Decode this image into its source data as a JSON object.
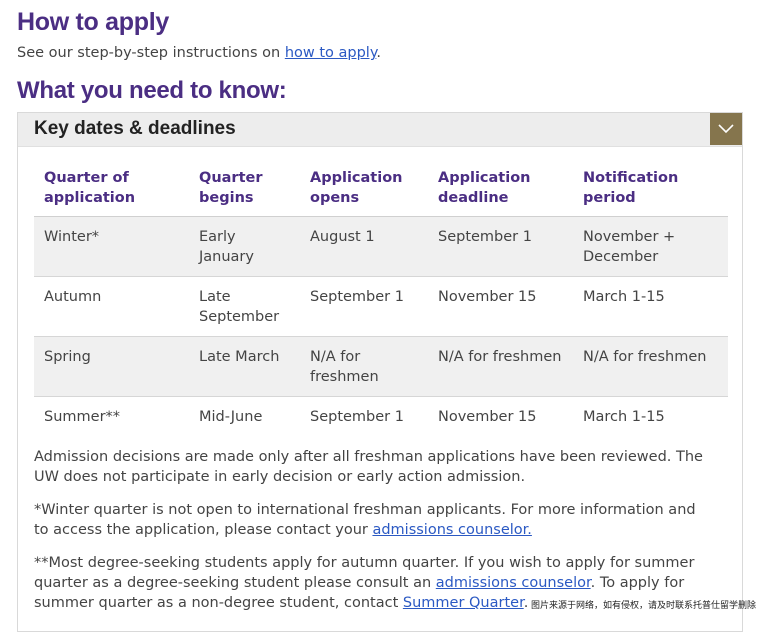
{
  "heading_apply": "How to apply",
  "intro": {
    "before": "See our step-by-step instructions on ",
    "link": "how to apply",
    "after": "."
  },
  "heading_know": "What you need to know:",
  "panel": {
    "title": "Key dates & deadlines",
    "toggle_icon": "chevron-down-icon"
  },
  "table": {
    "headers": [
      "Quarter of application",
      "Quarter begins",
      "Application opens",
      "Application deadline",
      "Notification period"
    ],
    "rows": [
      [
        "Winter*",
        "Early January",
        "August 1",
        "September 1",
        "November + December"
      ],
      [
        "Autumn",
        "Late September",
        "September 1",
        "November 15",
        "March 1-15"
      ],
      [
        "Spring",
        "Late March",
        "N/A for freshmen",
        "N/A for freshmen",
        "N/A for freshmen"
      ],
      [
        "Summer**",
        "Mid-June",
        "September 1",
        "November 15",
        "March 1-15"
      ]
    ]
  },
  "notes": {
    "decisions": "Admission decisions are made only after all freshman applications have been reviewed. The UW does not participate in early decision or early action admission.",
    "winter_before": "*Winter quarter is not open to international freshman applicants. For more information and to access the application, please contact your ",
    "winter_link": "admissions counselor.",
    "summer_before": "**Most degree-seeking students apply for autumn quarter. If you wish to apply for summer quarter as a degree-seeking student please consult an ",
    "summer_link1": "admissions counselor",
    "summer_middle": ". To apply for summer quarter as a non-degree student, contact ",
    "summer_link2": "Summer Quarter",
    "summer_after": "."
  },
  "watermark": "图片来源于网络，如有侵权，请及时联系托普仕留学删除",
  "colors": {
    "heading": "#4b2e83",
    "accent_gold": "#85754d",
    "link": "#2b59c3"
  }
}
